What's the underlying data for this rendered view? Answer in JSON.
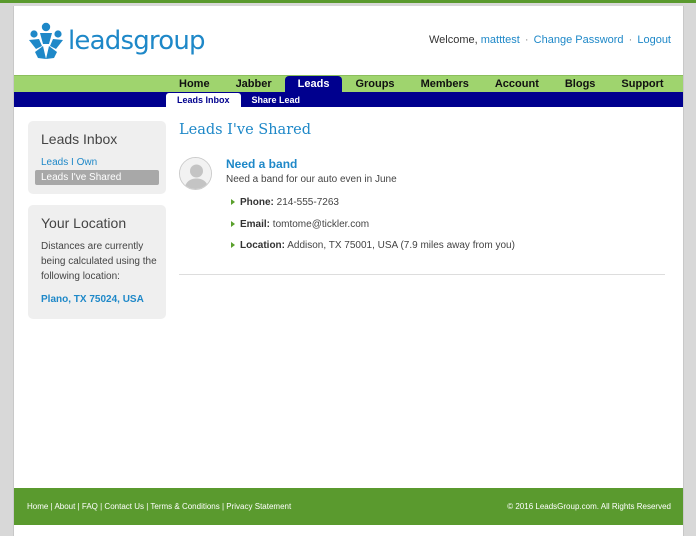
{
  "brand": {
    "logo_text": "leadsgroup"
  },
  "header": {
    "welcome_prefix": "Welcome,",
    "username": "matttest",
    "change_password": "Change Password",
    "logout": "Logout",
    "separator": "·"
  },
  "nav": {
    "items": [
      "Home",
      "Jabber",
      "Leads",
      "Groups",
      "Members",
      "Account",
      "Blogs",
      "Support"
    ],
    "active": "Leads"
  },
  "subnav": {
    "items": [
      "Leads Inbox",
      "Share Lead"
    ],
    "active": "Leads Inbox"
  },
  "sidebar": {
    "inbox_title": "Leads Inbox",
    "inbox_links": [
      "Leads I Own",
      "Leads I've Shared"
    ],
    "inbox_active": "Leads I've Shared",
    "location_title": "Your Location",
    "location_text": "Distances are currently being calculated using the following location:",
    "location_value": "Plano, TX 75024, USA"
  },
  "main": {
    "title": "Leads I've Shared",
    "lead": {
      "title": "Need a band",
      "description": "Need a band for our auto even in June",
      "phone_label": "Phone:",
      "phone": "214-555-7263",
      "email_label": "Email:",
      "email": "tomtome@tickler.com",
      "location_label": "Location:",
      "location": "Addison, TX 75001, USA (7.9 miles away from you)"
    }
  },
  "footer": {
    "links": [
      "Home",
      "About",
      "FAQ",
      "Contact Us",
      "Terms & Conditions",
      "Privacy Statement"
    ],
    "copyright": "© 2016 LeadsGroup.com. All Rights Reserved"
  },
  "colors": {
    "brand_blue": "#1e88c8",
    "nav_green": "#9fd46e",
    "nav_active": "#00008e",
    "footer_green": "#5a9a2e"
  }
}
